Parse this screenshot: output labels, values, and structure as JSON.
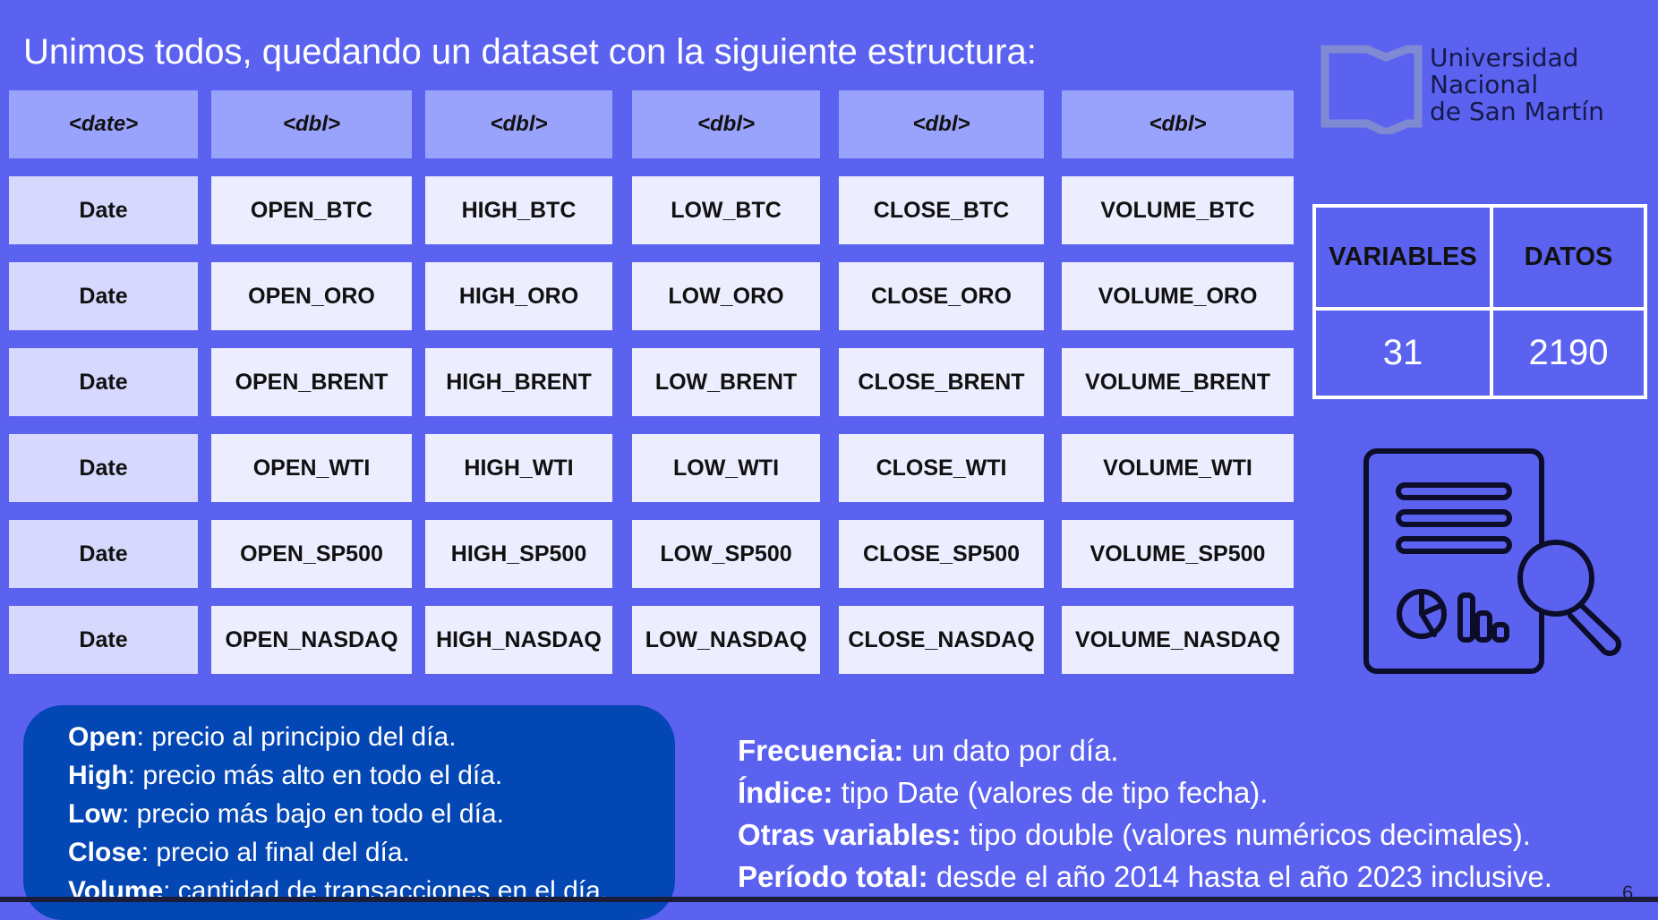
{
  "slide": {
    "title": "Unimos todos, quedando un dataset con la siguiente estructura:",
    "page_number": "6"
  },
  "logo": {
    "line1": "Universidad",
    "line2": "Nacional",
    "line3": "de San Martín"
  },
  "colors": {
    "background": "#5b62f0",
    "type_header": "#9aa3fb",
    "date_cell": "#d6d9fd",
    "variable_cell": "#ecedfe",
    "definitions_box": "#0347b4"
  },
  "table": {
    "types": [
      "<date>",
      "<dbl>",
      "<dbl>",
      "<dbl>",
      "<dbl>",
      "<dbl>"
    ],
    "rows": [
      [
        "Date",
        "OPEN_BTC",
        "HIGH_BTC",
        "LOW_BTC",
        "CLOSE_BTC",
        "VOLUME_BTC"
      ],
      [
        "Date",
        "OPEN_ORO",
        "HIGH_ORO",
        "LOW_ORO",
        "CLOSE_ORO",
        "VOLUME_ORO"
      ],
      [
        "Date",
        "OPEN_BRENT",
        "HIGH_BRENT",
        "LOW_BRENT",
        "CLOSE_BRENT",
        "VOLUME_BRENT"
      ],
      [
        "Date",
        "OPEN_WTI",
        "HIGH_WTI",
        "LOW_WTI",
        "CLOSE_WTI",
        "VOLUME_WTI"
      ],
      [
        "Date",
        "OPEN_SP500",
        "HIGH_SP500",
        "LOW_SP500",
        "CLOSE_SP500",
        "VOLUME_SP500"
      ],
      [
        "Date",
        "OPEN_NASDAQ",
        "HIGH_NASDAQ",
        "LOW_NASDAQ",
        "CLOSE_NASDAQ",
        "VOLUME_NASDAQ"
      ]
    ]
  },
  "stats": {
    "variables_label": "VARIABLES",
    "datos_label": "DATOS",
    "variables_value": "31",
    "datos_value": "2190"
  },
  "icons": {
    "logo": "open-book-icon",
    "report": "report-analysis-icon"
  },
  "definitions": [
    {
      "term": "Open",
      "text": ": precio al principio del día."
    },
    {
      "term": "High",
      "text": ": precio más alto en todo el día."
    },
    {
      "term": "Low",
      "text": ": precio más bajo en todo el día."
    },
    {
      "term": "Close",
      "text": ": precio al final del día."
    },
    {
      "term": "Volume",
      "text": ": cantidad de transacciones en el día."
    }
  ],
  "info": [
    {
      "label": "Frecuencia:",
      "text": " un dato por día."
    },
    {
      "label": "Índice:",
      "text": " tipo Date (valores de tipo fecha)."
    },
    {
      "label": "Otras variables:",
      "text": " tipo double (valores numéricos decimales)."
    },
    {
      "label": "Período total:",
      "text": " desde el año 2014 hasta el año 2023 inclusive."
    }
  ]
}
